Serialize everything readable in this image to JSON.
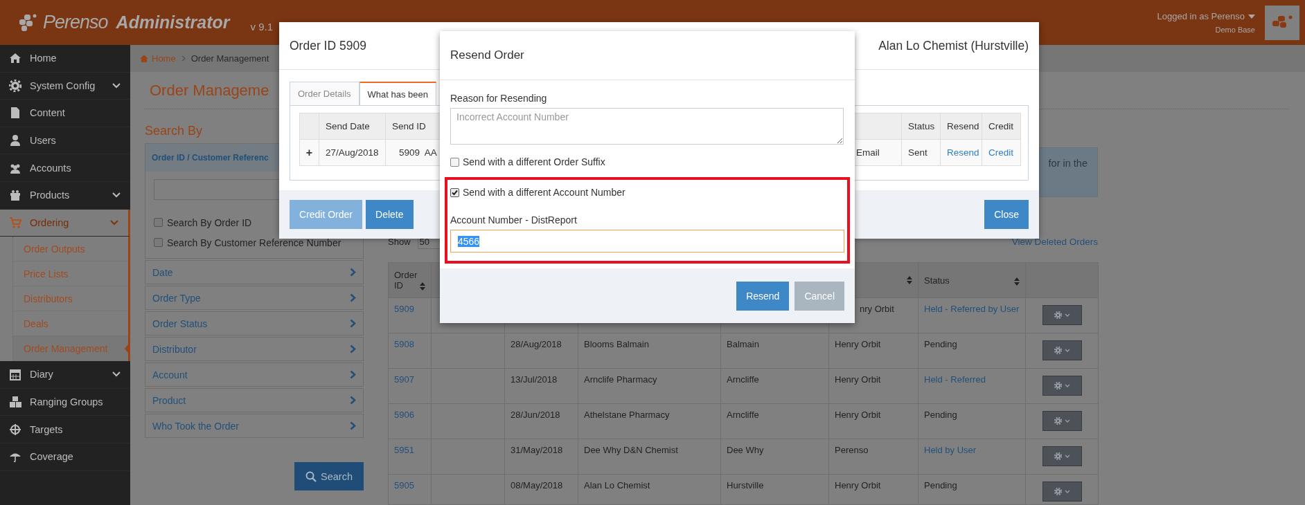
{
  "header": {
    "logo_name": "Perenso",
    "logo_product": "Administrator",
    "version": "v 9.1",
    "user": "Logged in as Perenso",
    "base": "Demo Base"
  },
  "sidebar": {
    "items": [
      {
        "label": "Home",
        "has_submenu": false,
        "selected": false
      },
      {
        "label": "System Config",
        "has_submenu": true,
        "selected": false
      },
      {
        "label": "Content",
        "has_submenu": false,
        "selected": false
      },
      {
        "label": "Users",
        "has_submenu": false,
        "selected": false
      },
      {
        "label": "Accounts",
        "has_submenu": false,
        "selected": false
      },
      {
        "label": "Products",
        "has_submenu": true,
        "selected": false
      },
      {
        "label": "Ordering",
        "has_submenu": true,
        "selected": true,
        "children": [
          {
            "label": "Order Outputs",
            "selected": false
          },
          {
            "label": "Price Lists",
            "selected": false
          },
          {
            "label": "Distributors",
            "selected": false
          },
          {
            "label": "Deals",
            "selected": false
          },
          {
            "label": "Order Management",
            "selected": true
          }
        ]
      },
      {
        "label": "Diary",
        "has_submenu": true,
        "selected": false
      },
      {
        "label": "Ranging Groups",
        "has_submenu": false,
        "selected": false
      },
      {
        "label": "Targets",
        "has_submenu": false,
        "selected": false
      },
      {
        "label": "Coverage",
        "has_submenu": false,
        "selected": false
      }
    ]
  },
  "breadcrumb": [
    "Home",
    "Order Management"
  ],
  "page": {
    "title": "Order Manageme",
    "search_heading": "Search By",
    "search_panel": {
      "title": "Order ID / Customer Referenc",
      "options": [
        {
          "label": "Search By Order ID",
          "checked": false
        },
        {
          "label": "Search By Customer Reference Number",
          "checked": false
        }
      ]
    },
    "filters": [
      "Date",
      "Order Type",
      "Order Status",
      "Distributor",
      "Account",
      "Product",
      "Who Took the Order"
    ],
    "search_button": "Search"
  },
  "results": {
    "info": "for in the",
    "show_label": "Show",
    "page_size": "50",
    "deleted_link": "View Deleted Orders",
    "columns": [
      {
        "label": "Order ID",
        "sortable": true
      },
      {
        "sortable": true
      },
      {
        "label": "Status",
        "sortable": true
      }
    ],
    "rows": [
      {
        "order_id": "5909",
        "rep": "nry Orbit",
        "status": "Held - Referred by User",
        "status_link": true
      },
      {
        "order_id": "5908",
        "date": "28/Aug/2018",
        "account": "Blooms Balmain",
        "suburb": "Balmain",
        "rep": "Henry Orbit",
        "status": "Pending",
        "status_link": false
      },
      {
        "order_id": "5907",
        "date": "13/Jul/2018",
        "account": "Arnclife Pharmacy",
        "suburb": "Arncliffe",
        "rep": "Henry Orbit",
        "status": "Held - Referred",
        "status_link": true
      },
      {
        "order_id": "5906",
        "date": "28/Jun/2018",
        "account": "Athelstane Pharmacy",
        "suburb": "Arncliffe",
        "rep": "Henry Orbit",
        "status": "Pending",
        "status_link": false
      },
      {
        "order_id": "5951",
        "date": "31/May/2018",
        "account": "Dee Why D&N Chemist",
        "suburb": "Dee Why",
        "rep": "Perenso",
        "status": "Held by User",
        "status_link": true
      },
      {
        "order_id": "5905",
        "date": "08/May/2018",
        "account": "Alan Lo Chemist",
        "suburb": "Hurstville",
        "rep": "Henry Orbit",
        "status": "Pending",
        "status_link": false
      }
    ]
  },
  "order_dialog": {
    "title": "Order ID 5909",
    "customer": "Alan Lo Chemist (Hurstville)",
    "tabs": [
      {
        "label": "Order Details",
        "selected": false
      },
      {
        "label": "What has been",
        "selected": true
      }
    ],
    "columns": [
      "Send Date",
      "Send ID",
      "Status",
      "Resend",
      "Credit"
    ],
    "rows": [
      {
        "toggle": "+",
        "send_date": "27/Aug/2018",
        "send_id": "5909  AA",
        "method": "Email",
        "status": "Sent",
        "resend": "Resend",
        "credit": "Credit"
      }
    ],
    "buttons": [
      {
        "label": "Credit Order",
        "disabled": true
      },
      {
        "label": "Delete",
        "disabled": false
      }
    ],
    "close": "Close"
  },
  "resend_dialog": {
    "title": "Resend Order",
    "reason_label": "Reason for Resending",
    "reason_placeholder": "Incorrect Account Number",
    "options": [
      {
        "label": "Send with a different Order Suffix",
        "checked": false,
        "highlighted": false
      },
      {
        "label": "Send with a different Account Number",
        "checked": true,
        "highlighted": true
      }
    ],
    "account_label": "Account Number - DistReport",
    "account_value": "4566",
    "value_selected": true,
    "buttons": [
      {
        "label": "Resend",
        "kind": "primary"
      },
      {
        "label": "Cancel",
        "kind": "secondary"
      }
    ]
  }
}
